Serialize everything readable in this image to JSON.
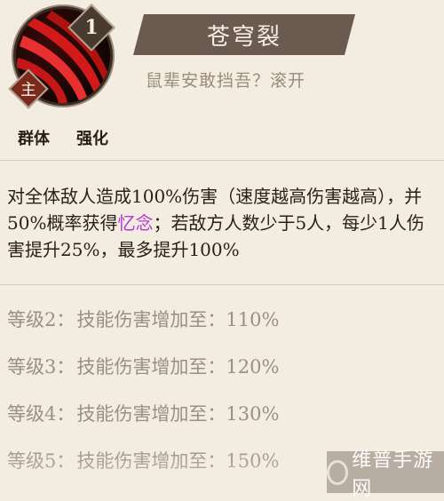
{
  "skill": {
    "level": "1",
    "role_badge": "主",
    "name": "苍穹裂",
    "quote": "鼠辈安敢挡吾？滚开",
    "icon": "crimson-slash-icon"
  },
  "tags": [
    "群体",
    "强化"
  ],
  "description": {
    "before": "对全体敌人造成100%伤害（速度越高伤害越高），并50%概率获得",
    "highlight": "忆念",
    "after": "；若敌方人数少于5人，每少1人伤害提升25%，最多提升100%"
  },
  "levels": [
    {
      "label": "等级2：",
      "text": "技能伤害增加至：110%"
    },
    {
      "label": "等级3：",
      "text": "技能伤害增加至：120%"
    },
    {
      "label": "等级4：",
      "text": "技能伤害增加至：130%"
    },
    {
      "label": "等级5：",
      "text": "技能伤害增加至：150%"
    }
  ],
  "watermark": "维普手游网",
  "colors": {
    "highlight": "#b43ad0",
    "banner": "#6b5a4f",
    "background": "#f3ece0"
  }
}
